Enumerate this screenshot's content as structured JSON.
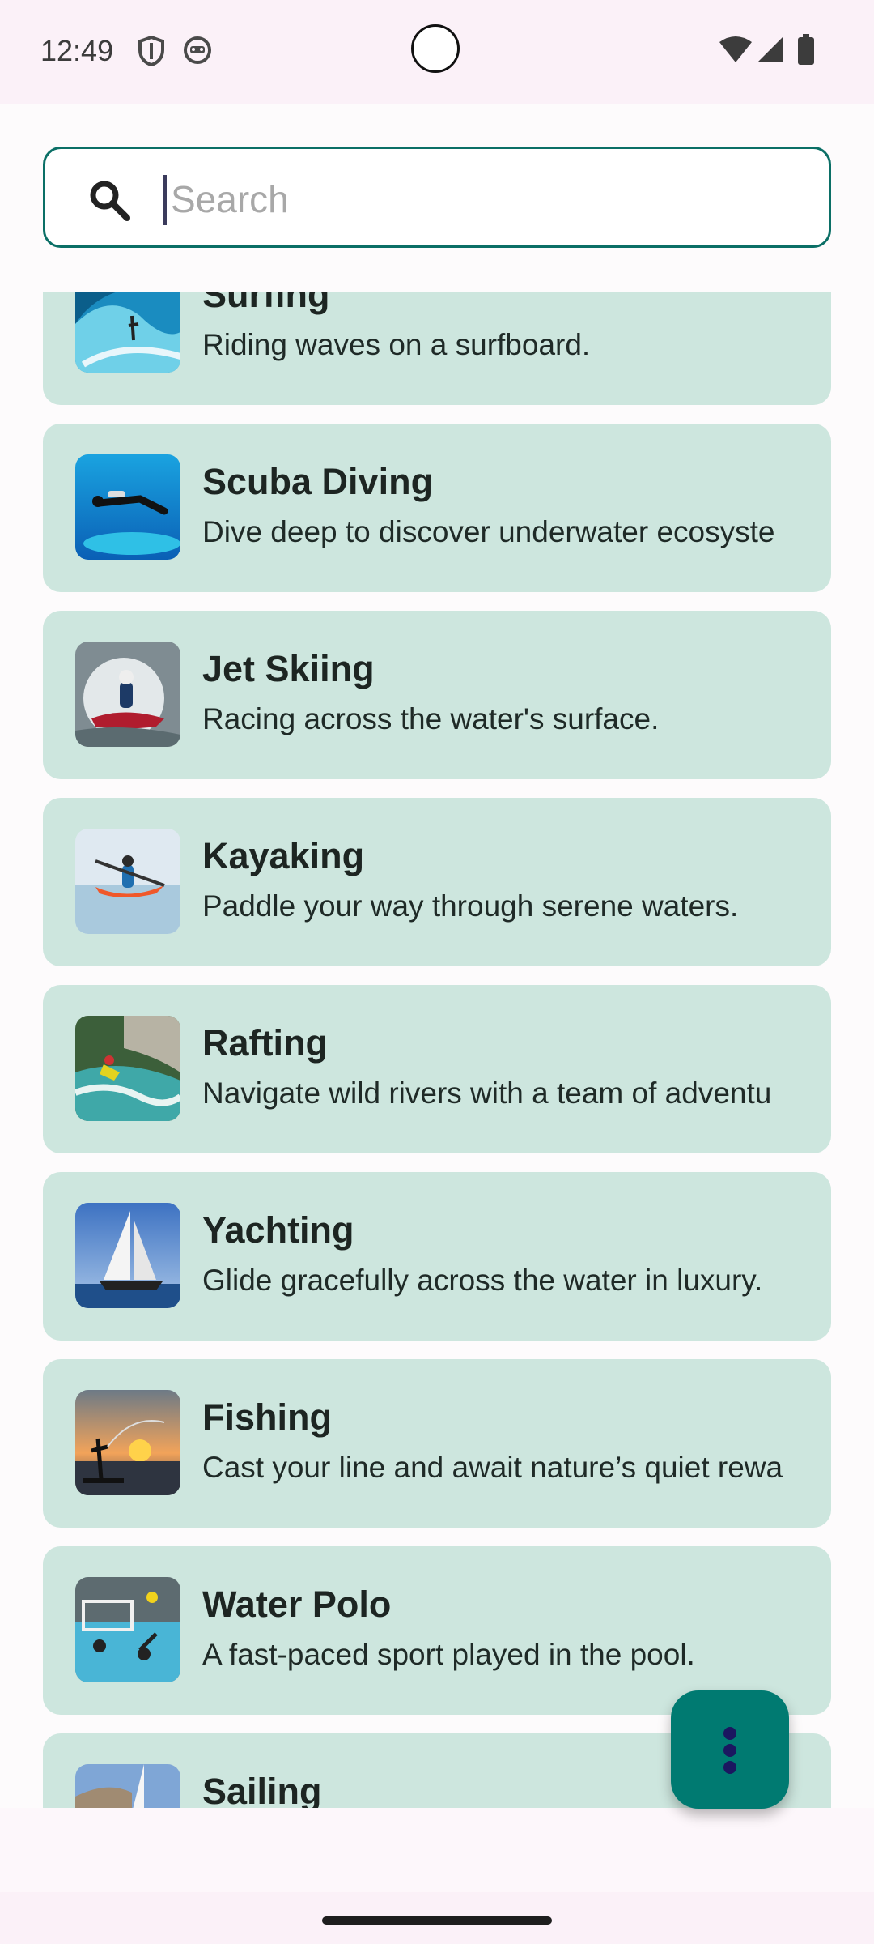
{
  "status_bar": {
    "time": "12:49",
    "icons": [
      "shield-icon",
      "face-icon",
      "wifi-icon",
      "signal-icon",
      "battery-icon"
    ]
  },
  "search": {
    "placeholder": "Search",
    "value": "",
    "icon": "search-icon"
  },
  "activities": [
    {
      "title": "Surfing",
      "description": "Riding waves on a surfboard.",
      "image": "surfing-photo"
    },
    {
      "title": "Scuba Diving",
      "description": "Dive deep to discover underwater ecosyste",
      "image": "scuba-photo"
    },
    {
      "title": "Jet Skiing",
      "description": "Racing across the water's surface.",
      "image": "jetski-photo"
    },
    {
      "title": "Kayaking",
      "description": "Paddle your way through serene waters.",
      "image": "kayak-photo"
    },
    {
      "title": "Rafting",
      "description": "Navigate wild rivers with a team of adventu",
      "image": "rafting-photo"
    },
    {
      "title": "Yachting",
      "description": "Glide gracefully across the water in luxury.",
      "image": "yacht-photo"
    },
    {
      "title": "Fishing",
      "description": "Cast your line and await nature’s quiet rewa",
      "image": "fishing-photo"
    },
    {
      "title": "Water Polo",
      "description": "A fast-paced sport played in the pool.",
      "image": "waterpolo-photo"
    },
    {
      "title": "Sailing",
      "description": "",
      "image": "sailing-photo"
    }
  ],
  "fab": {
    "icon": "more-vertical-icon"
  },
  "colors": {
    "card_bg": "#cde6de",
    "accent": "#007a71",
    "search_border": "#0b6f66"
  }
}
